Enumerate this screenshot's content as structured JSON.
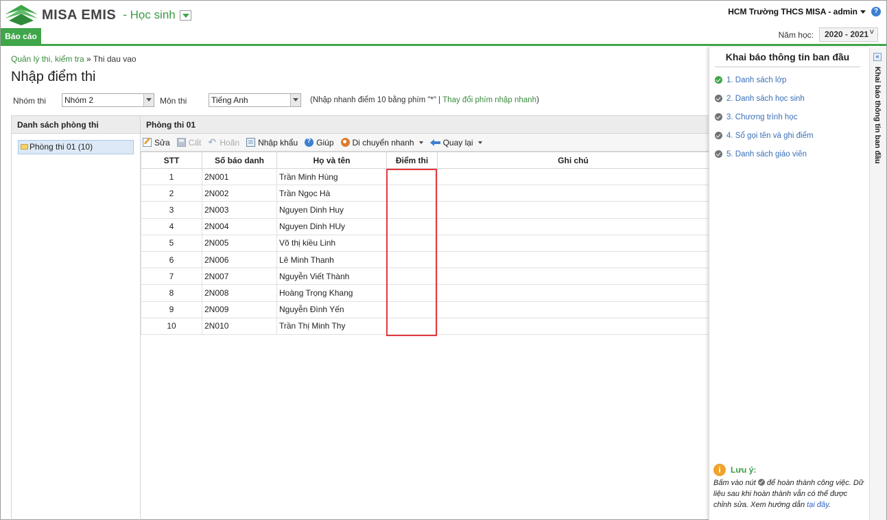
{
  "header": {
    "brand": "MISA EMIS",
    "module": "- Học sinh",
    "tab_report": "Báo cáo",
    "user": "HCM Trường THCS MISA - admin",
    "year_label": "Năm học:",
    "year_value": "2020 - 2021"
  },
  "breadcrumb": {
    "parent": "Quản lý thi, kiểm tra",
    "separator": " » ",
    "current": "Thi dau vao"
  },
  "page_title": "Nhập điểm thi",
  "filters": {
    "group_label": "Nhóm thi",
    "group_value": "Nhóm 2",
    "subject_label": "Môn thi",
    "subject_value": "Tiếng Anh",
    "hint_text": "(Nhập nhanh điểm 10 bằng phím \"*\" | ",
    "hint_link": "Thay đổi phím nhập nhanh",
    "hint_end": ")"
  },
  "left_panel": {
    "title": "Danh sách phòng thi",
    "rooms": [
      "Phòng thi 01 (10)"
    ]
  },
  "content": {
    "title": "Phòng thi 01",
    "toolbar": {
      "edit": "Sửa",
      "save": "Cất",
      "undo": "Hoãn",
      "import": "Nhập khẩu",
      "help": "Giúp",
      "quick_move": "Di chuyển nhanh",
      "back": "Quay lại"
    },
    "columns": [
      "STT",
      "Số báo danh",
      "Họ và tên",
      "Điểm thi",
      "Ghi chú"
    ],
    "rows": [
      {
        "stt": "1",
        "sbd": "2N001",
        "name": "Trần Minh Hùng",
        "score": "",
        "note": ""
      },
      {
        "stt": "2",
        "sbd": "2N002",
        "name": "Trần Ngọc Hà",
        "score": "",
        "note": ""
      },
      {
        "stt": "3",
        "sbd": "2N003",
        "name": "Nguyen Dinh Huy",
        "score": "",
        "note": ""
      },
      {
        "stt": "4",
        "sbd": "2N004",
        "name": "Nguyen Dinh HUy",
        "score": "",
        "note": ""
      },
      {
        "stt": "5",
        "sbd": "2N005",
        "name": "Võ thị kiều Linh",
        "score": "",
        "note": ""
      },
      {
        "stt": "6",
        "sbd": "2N006",
        "name": "Lê Minh Thanh",
        "score": "",
        "note": ""
      },
      {
        "stt": "7",
        "sbd": "2N007",
        "name": "Nguyễn Viết Thành",
        "score": "",
        "note": ""
      },
      {
        "stt": "8",
        "sbd": "2N008",
        "name": "Hoàng Trọng Khang",
        "score": "",
        "note": ""
      },
      {
        "stt": "9",
        "sbd": "2N009",
        "name": "Nguyễn Đình Yến",
        "score": "",
        "note": ""
      },
      {
        "stt": "10",
        "sbd": "2N010",
        "name": "Trần Thị Minh Thy",
        "score": "",
        "note": ""
      }
    ]
  },
  "side_panel": {
    "title": "Khai báo thông tin ban đầu",
    "steps": [
      {
        "label": "1. Danh sách lớp",
        "done": true
      },
      {
        "label": "2. Danh sách học sinh",
        "done": false
      },
      {
        "label": "3. Chương trình học",
        "done": false
      },
      {
        "label": "4. Sổ gọi tên và ghi điểm",
        "done": false
      },
      {
        "label": "5. Danh sách giáo viên",
        "done": false
      }
    ],
    "note_title": "Lưu ý:",
    "note_part1": "Bấm vào nút ",
    "note_part2": " để hoàn thành công việc. Dữ liệu sau khi hoàn thành vẫn có thể được chỉnh sửa. Xem hướng dẫn ",
    "note_link": "tại đây",
    "note_end": ".",
    "vertical_tab": "Khai báo thông tin ban đầu",
    "collapse_glyph": "«"
  },
  "colors": {
    "accent": "#3fa64a",
    "highlight": "#e3383d",
    "link": "#3a8a3e"
  }
}
